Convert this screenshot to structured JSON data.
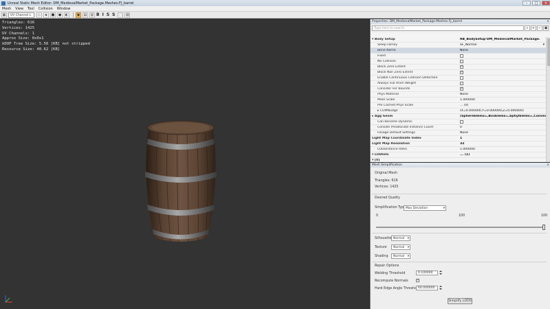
{
  "window": {
    "title": "Unreal Static Mesh Editor: DM_MedievalMarket_Package.Meshes.FJ_barrel",
    "minimize": "–",
    "maximize": "□",
    "close": "✕"
  },
  "menu": [
    "Mesh",
    "View",
    "Tool",
    "Collision",
    "Window"
  ],
  "toolbar": {
    "uv_channel": "UV Channel L",
    "letters": [
      "B",
      "I",
      "S",
      "S"
    ]
  },
  "viewport": {
    "stats": [
      "Triangles:  616",
      "Vertices:  1425",
      "UV Channels:  1",
      "Approx Size: 0x0x1",
      "kDOP Tree Size: 5.56 [KB] not stripped",
      "Resource Size: 40.62 [KB]"
    ]
  },
  "properties": {
    "header": "Properties: DM_MedievalMarket_Package.Meshes.FJ_barrel",
    "search_placeholder": "Type here to search",
    "rows": [
      {
        "name": "▾ Body Setup",
        "value": "RB_BodySetup'DM_MedievalMarket_Package.",
        "bold": true,
        "kind": "text"
      },
      {
        "name": "Sleep Family",
        "value": "SF_Normal",
        "kind": "select"
      },
      {
        "name": "Bone Name",
        "value": "None",
        "kind": "text",
        "selected": true
      },
      {
        "name": "Fixed",
        "value": "",
        "kind": "check",
        "checked": false
      },
      {
        "name": "No Collision",
        "value": "",
        "kind": "check",
        "checked": false
      },
      {
        "name": "Block Zero Extent",
        "value": "",
        "kind": "check",
        "checked": true
      },
      {
        "name": "Block Non Zero Extent",
        "value": "",
        "kind": "check",
        "checked": true
      },
      {
        "name": "Enable Continuous Collision Detection",
        "value": "",
        "kind": "check",
        "checked": false
      },
      {
        "name": "Always Full Anim Weight",
        "value": "",
        "kind": "check",
        "checked": false
      },
      {
        "name": "Consider For Bounds",
        "value": "",
        "kind": "check",
        "checked": true
      },
      {
        "name": "Phys Material",
        "value": "None",
        "kind": "text"
      },
      {
        "name": "Mass Scale",
        "value": "1.000000",
        "kind": "text"
      },
      {
        "name": "Pre Cached Phys Scale",
        "value": "... (0)",
        "kind": "text"
      },
      {
        "name": "▸ COMNudge",
        "value": "(X=0.000000,Y=0.000000,Z=0.000000)",
        "kind": "text"
      },
      {
        "name": "▸ Agg Geom",
        "value": "(SphereElems=,BoxElems=,SphylElems=,ConvexEle",
        "bold": true,
        "kind": "text"
      },
      {
        "name": "Can Become Dynamic",
        "value": "",
        "kind": "check",
        "checked": false
      },
      {
        "name": "Console Preallocate Instance Count",
        "value": "0",
        "kind": "text"
      },
      {
        "name": "Foliage Default Settings",
        "value": "None",
        "kind": "text"
      },
      {
        "name": "Light Map Coordinate Index",
        "value": "1",
        "bold": true,
        "kind": "text"
      },
      {
        "name": "Light Map Resolution",
        "value": "32",
        "bold": true,
        "kind": "text"
      },
      {
        "name": "LODDistance Ratio",
        "value": "1.000000",
        "kind": "text"
      },
      {
        "name": "▾ LODInfo",
        "value": "... (1)",
        "bold": true,
        "kind": "text"
      },
      {
        "name": "  ▾ [0]",
        "value": "",
        "bold": true,
        "kind": "text"
      }
    ]
  },
  "mesh_simplification": {
    "header": "Mesh Simplification",
    "original_mesh": "Original Mesh",
    "triangles": "Triangles: 616",
    "vertices": "Vertices: 1425",
    "desired_quality": "Desired Quality",
    "simplification_type_label": "Simplification Type",
    "simplification_type_value": "Max Deviation",
    "slider_min": "0",
    "slider_mid": "100",
    "slider_max": "100",
    "slider_level_percent": 100,
    "silhouette_label": "Silhouette",
    "silhouette_value": "Normal",
    "texture_label": "Texture",
    "texture_value": "Normal",
    "shading_label": "Shading",
    "shading_value": "Normal",
    "repair_options": "Repair Options",
    "welding_label": "Welding Threshold",
    "welding_value": "0.100000",
    "recompute_label": "Recompute Normals",
    "recompute_checked": true,
    "hard_edge_label": "Hard Edge Angle Threshold",
    "hard_edge_value": "60.000000",
    "simplify_button": "Simplify LOD0"
  }
}
